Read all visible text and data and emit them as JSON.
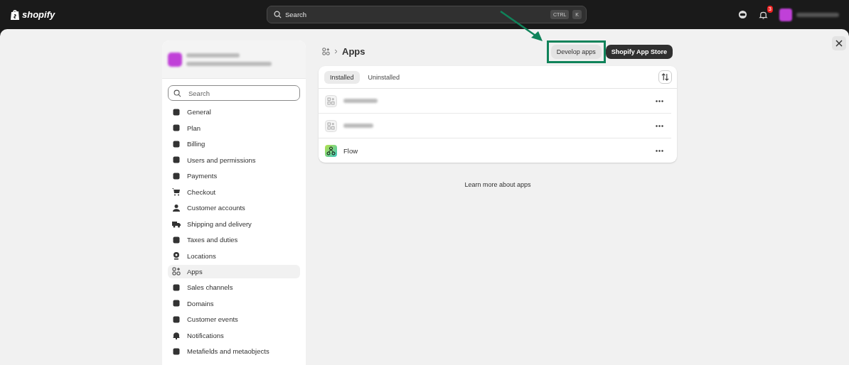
{
  "topbar": {
    "logo": "shopify",
    "search": {
      "placeholder": "Search",
      "keys": [
        "CTRL",
        "K"
      ]
    },
    "notification_count": "3"
  },
  "sidebar": {
    "search": {
      "placeholder": "Search"
    },
    "items": [
      {
        "label": "General",
        "selected": false
      },
      {
        "label": "Plan",
        "selected": false
      },
      {
        "label": "Billing",
        "selected": false
      },
      {
        "label": "Users and permissions",
        "selected": false
      },
      {
        "label": "Payments",
        "selected": false
      },
      {
        "label": "Checkout",
        "selected": false
      },
      {
        "label": "Customer accounts",
        "selected": false
      },
      {
        "label": "Shipping and delivery",
        "selected": false
      },
      {
        "label": "Taxes and duties",
        "selected": false
      },
      {
        "label": "Locations",
        "selected": false
      },
      {
        "label": "Apps",
        "selected": true
      },
      {
        "label": "Sales channels",
        "selected": false
      },
      {
        "label": "Domains",
        "selected": false
      },
      {
        "label": "Customer events",
        "selected": false
      },
      {
        "label": "Notifications",
        "selected": false
      },
      {
        "label": "Metafields and metaobjects",
        "selected": false
      }
    ]
  },
  "page": {
    "title": "Apps",
    "buttons": [
      {
        "label": "Develop apps",
        "kind": "secondary",
        "highlighted": true
      },
      {
        "label": "Shopify App Store",
        "kind": "primary",
        "highlighted": false
      }
    ],
    "tabs": [
      {
        "label": "Installed",
        "selected": true
      },
      {
        "label": "Uninstalled",
        "selected": false
      }
    ],
    "apps": [
      {
        "kind": "redacted"
      },
      {
        "kind": "redacted"
      },
      {
        "kind": "flow",
        "name": "Flow"
      }
    ],
    "footer_link": "Learn more about apps"
  }
}
